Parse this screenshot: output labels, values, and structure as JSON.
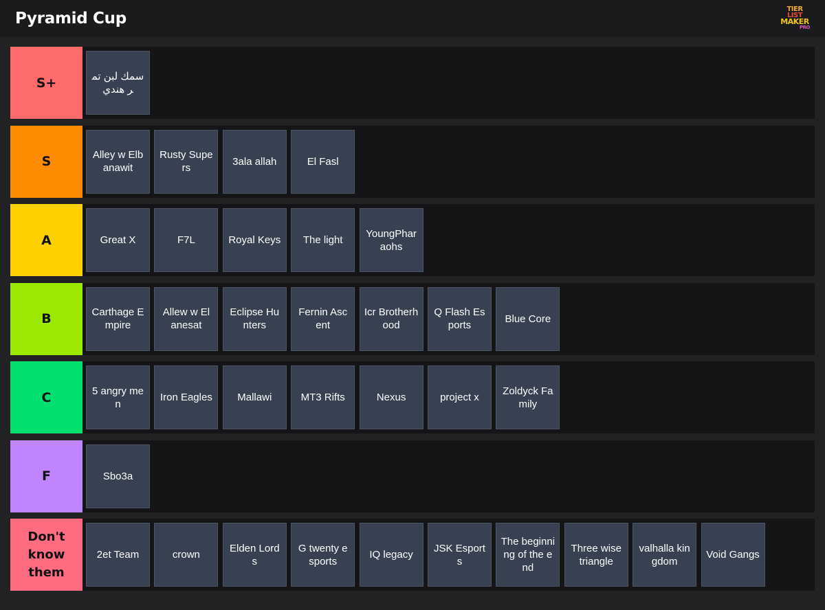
{
  "header": {
    "title": "Pyramid Cup",
    "logo": {
      "line1": "TIER",
      "line2": "LIST",
      "line3": "MAKER",
      "line4": "PRO"
    }
  },
  "tiers": [
    {
      "label": "S+",
      "color": "#ff6b6b",
      "items": [
        "سمك لبن تمر هندي"
      ]
    },
    {
      "label": "S",
      "color": "#ff8c00",
      "items": [
        "Alley w Elbanawit",
        "Rusty Supers",
        "3ala allah",
        "El Fasl"
      ]
    },
    {
      "label": "A",
      "color": "#ffd000",
      "items": [
        "Great X",
        "F7L",
        "Royal Keys",
        "The light",
        "YoungPharaohs"
      ]
    },
    {
      "label": "B",
      "color": "#9be800",
      "items": [
        "Carthage Empire",
        "Allew w El anesat",
        "Eclipse Hunters",
        "Fernin Ascent",
        "Icr Brotherhood",
        "Q Flash Esports",
        "Blue Core"
      ]
    },
    {
      "label": "C",
      "color": "#00e06f",
      "items": [
        "5 angry men",
        "Iron Eagles",
        "Mallawi",
        "MT3 Rifts",
        "Nexus",
        "project x",
        "Zoldyck Family"
      ]
    },
    {
      "label": "F",
      "color": "#c084fc",
      "items": [
        "Sbo3a"
      ]
    },
    {
      "label": "Don't know them",
      "color": "#ff6b81",
      "items": [
        "2et Team",
        "crown",
        "Elden Lords",
        "G twenty esports",
        "IQ legacy",
        "JSK Esports",
        "The beginning of the end",
        "Three wise triangle",
        "valhalla kingdom",
        "Void Gangs"
      ]
    }
  ]
}
